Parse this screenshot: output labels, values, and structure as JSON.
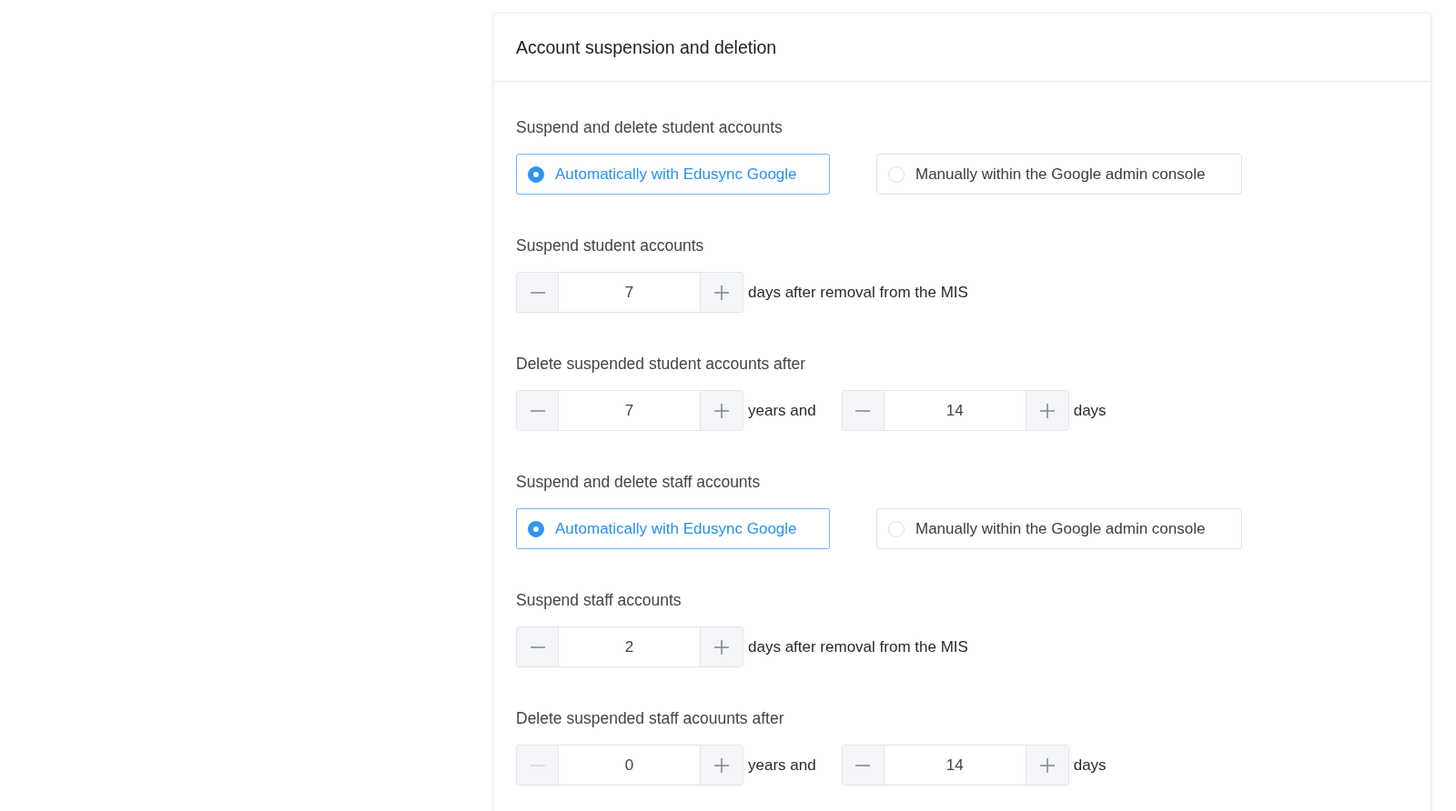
{
  "card": {
    "title": "Account suspension and deletion"
  },
  "sections": [
    {
      "kind": "radio",
      "label": "Suspend and delete student accounts",
      "options": [
        {
          "label": "Automatically with Edusync Google",
          "selected": true
        },
        {
          "label": "Manually within the Google admin console",
          "selected": false
        }
      ]
    },
    {
      "kind": "stepper",
      "label": "Suspend student accounts",
      "steppers": [
        {
          "value": "7",
          "decrement_disabled": false,
          "suffix": "days after removal from the MIS"
        }
      ]
    },
    {
      "kind": "stepper",
      "label": "Delete suspended student accounts after",
      "steppers": [
        {
          "value": "7",
          "decrement_disabled": false,
          "suffix": "years and"
        },
        {
          "value": "14",
          "decrement_disabled": false,
          "suffix": "days"
        }
      ]
    },
    {
      "kind": "radio",
      "label": "Suspend and delete staff accounts",
      "options": [
        {
          "label": "Automatically with Edusync Google",
          "selected": true
        },
        {
          "label": "Manually within the Google admin console",
          "selected": false
        }
      ]
    },
    {
      "kind": "stepper",
      "label": "Suspend staff accounts",
      "steppers": [
        {
          "value": "2",
          "decrement_disabled": false,
          "suffix": "days after removal from the MIS"
        }
      ]
    },
    {
      "kind": "stepper",
      "label": "Delete suspended staff acouunts after",
      "steppers": [
        {
          "value": "0",
          "decrement_disabled": true,
          "suffix": "years and"
        },
        {
          "value": "14",
          "decrement_disabled": false,
          "suffix": "days"
        }
      ]
    }
  ]
}
